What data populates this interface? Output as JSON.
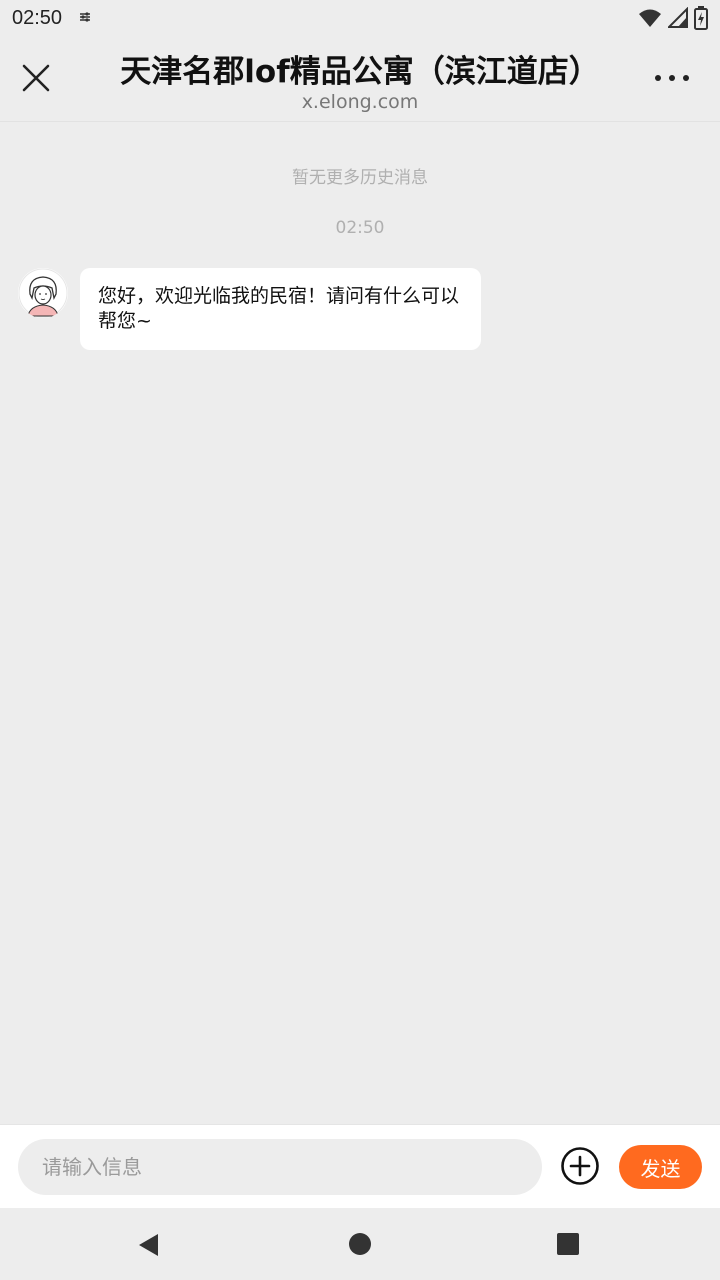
{
  "status_bar": {
    "time": "02:50",
    "icons": [
      "notification-icon",
      "wifi-icon",
      "signal-icon",
      "battery-charging-icon"
    ]
  },
  "header": {
    "title": "天津名郡lof精品公寓（滨江道店）",
    "subtitle": "x.elong.com",
    "close_icon": "close-icon",
    "more_icon": "more-icon"
  },
  "chat": {
    "no_history": "暂无更多历史消息",
    "timestamp": "02:50",
    "messages": [
      {
        "sender": "host",
        "text": "您好，欢迎光临我的民宿！请问有什么可以帮您~"
      }
    ]
  },
  "composer": {
    "placeholder": "请输入信息",
    "value": "",
    "send_label": "发送",
    "plus_icon": "plus-circle-icon"
  },
  "nav": {
    "back_icon": "back-triangle-icon",
    "home_icon": "home-circle-icon",
    "recents_icon": "recents-square-icon"
  },
  "colors": {
    "accent": "#ff6a1f",
    "background": "#ededed",
    "bubble": "#ffffff"
  }
}
